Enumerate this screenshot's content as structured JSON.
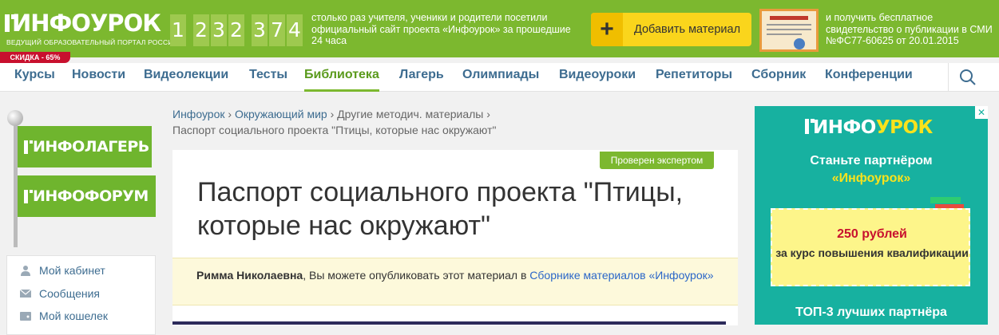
{
  "header": {
    "logo_text": "ИНФОУРОК",
    "logo_tagline": "ВЕДУЩИЙ ОБРАЗОВАТЕЛЬНЫЙ ПОРТАЛ РОССИИ",
    "sale_badge": "СКИДКА - 65%",
    "counter_digits": [
      "1",
      "2",
      "3",
      "2",
      "3",
      "7",
      "4"
    ],
    "counter_text": "столько раз учителя, ученики и родители посетили официальный сайт проекта «Инфоурок» за прошедшие 24 часа",
    "add_button_label": "Добавить материал",
    "certificate_text": "и получить бесплатное свидетельство о публикации в СМИ №ФС77-60625 от 20.01.2015",
    "brand_color": "#7cb82f"
  },
  "nav": {
    "items": [
      {
        "label": "Курсы"
      },
      {
        "label": "Новости"
      },
      {
        "label": "Видеолекции"
      },
      {
        "label": "Тесты"
      },
      {
        "label": "Библиотека",
        "active": true
      },
      {
        "label": "Лагерь"
      },
      {
        "label": "Олимпиады"
      },
      {
        "label": "Видеоуроки"
      },
      {
        "label": "Репетиторы"
      },
      {
        "label": "Сборник"
      },
      {
        "label": "Конференции"
      }
    ]
  },
  "sidebar": {
    "flag1_a": "ИНФО",
    "flag1_b": "ЛАГЕРЬ",
    "flag2_a": "ИНФО",
    "flag2_b": "ФОРУМ",
    "cabinet": [
      {
        "label": "Мой кабинет",
        "icon": "user-icon"
      },
      {
        "label": "Сообщения",
        "icon": "envelope-icon"
      },
      {
        "label": "Мой кошелек",
        "icon": "wallet-icon"
      }
    ]
  },
  "breadcrumb": {
    "level1": "Инфоурок",
    "sep": "›",
    "level2": "Окружающий мир",
    "level3": "Другие методич. материалы",
    "current": "Паспорт социального проекта \"Птицы, которые нас окружают\""
  },
  "material": {
    "expert_badge": "Проверен экспертом",
    "title": "Паспорт социального проекта \"Птицы, которые нас окружают\"",
    "notice_user": "Римма Николаевна",
    "notice_text": ", Вы можете опубликовать этот материал в ",
    "notice_link": "Сборнике материалов «Инфоурок»"
  },
  "ad": {
    "logo_a": "ИНФО",
    "logo_b": "УРОК",
    "heading_line1": "Станьте партнёром",
    "heading_line2": "«Инфоурок»",
    "price": "250 рублей",
    "desc": "за курс повышения квалификации",
    "bottom": "ТОП-3 лучших партнёра",
    "close": "✕"
  }
}
